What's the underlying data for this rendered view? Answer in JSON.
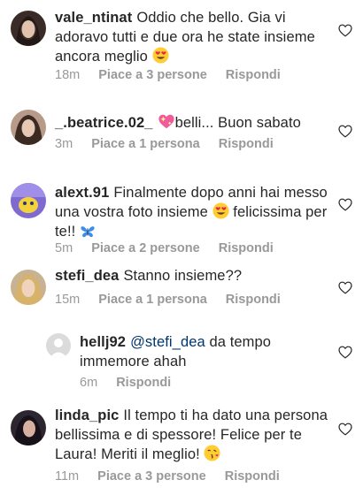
{
  "comments": [
    {
      "username": "vale_ntinat",
      "text": "Oddio che bello. Gia vi adoravo tutti e due ora he state insieme ancora meglio",
      "emoji_after": "heart-eyes-emoji",
      "time": "18m",
      "likes": "Piace a 3 persone",
      "reply": "Rispondi",
      "avatar_icon": "dark-hair-avatar"
    },
    {
      "username": "_.beatrice.02_",
      "emoji_before": "sparkling-heart-emoji",
      "text": "belli... Buon sabato",
      "time": "3m",
      "likes": "Piace a 1 persona",
      "reply": "Rispondi",
      "avatar_icon": "brown-hair-avatar"
    },
    {
      "username": "alext.91",
      "text": "Finalmente dopo anni hai messo una vostra foto insieme",
      "text_after": "felicissima per te!!",
      "emoji_mid": "heart-eyes-emoji",
      "emoji_end": "blue-butterfly-emoji",
      "time": "5m",
      "likes": "Piace a 2 persone",
      "reply": "Rispondi",
      "avatar_icon": "purple-art-avatar"
    },
    {
      "username": "stefi_dea",
      "text": "Stanno insieme??",
      "time": "15m",
      "likes": "Piace a 1 persona",
      "reply": "Rispondi",
      "avatar_icon": "blonde-avatar"
    },
    {
      "username": "hellj92",
      "mention": "@stefi_dea",
      "text": "da tempo immemore ahah",
      "time": "6m",
      "reply": "Rispondi",
      "avatar_icon": "default-avatar"
    },
    {
      "username": "linda_pic",
      "text": "Il tempo ti ha dato una persona bellissima e di spessore! Felice per te Laura! Meriti il meglio!",
      "emoji_after": "kiss-emoji",
      "time": "11m",
      "likes": "Piace a 3 persone",
      "reply": "Rispondi",
      "avatar_icon": "dark-avatar"
    }
  ],
  "colors": {
    "text": "#262626",
    "meta": "#999999",
    "mention": "#003569",
    "heart_outline": "#262626"
  },
  "icons": {
    "like": "heart-outline-icon"
  }
}
